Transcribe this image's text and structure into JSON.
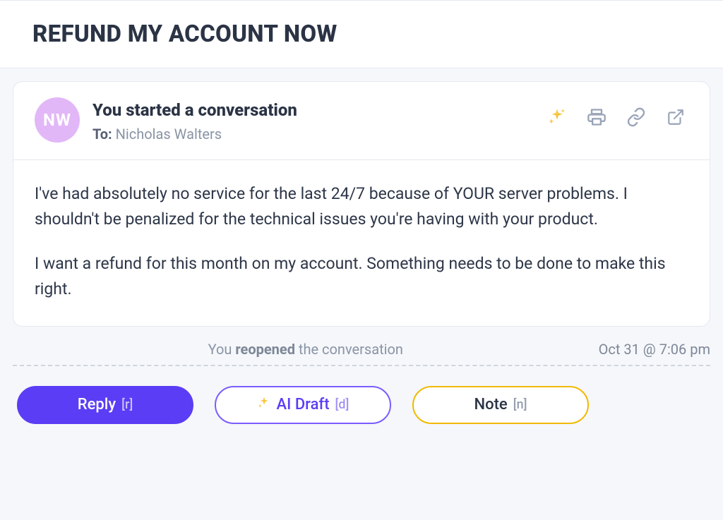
{
  "subject": "REFUND MY ACCOUNT NOW",
  "message": {
    "avatarInitials": "NW",
    "title": "You started a conversation",
    "toLabel": "To:",
    "toName": "Nicholas Walters",
    "body": {
      "p1": "I've had absolutely no service for the last 24/7 because of YOUR server problems. I shouldn't be penalized for the technical issues you're having with your product.",
      "p2": "I want a refund for this month on my account. Something needs to be done to make this right."
    }
  },
  "log": {
    "prefix": "You ",
    "emphasis": "reopened",
    "suffix": " the conversation",
    "timestamp": "Oct 31 @ 7:06 pm"
  },
  "actions": {
    "reply": {
      "label": "Reply",
      "shortcut": "[r]"
    },
    "aiDraft": {
      "label": "AI Draft",
      "shortcut": "[d]"
    },
    "note": {
      "label": "Note",
      "shortcut": "[n]"
    }
  },
  "icons": {
    "spark": "ai-spark-icon",
    "print": "print-icon",
    "link": "link-icon",
    "open": "open-external-icon"
  }
}
